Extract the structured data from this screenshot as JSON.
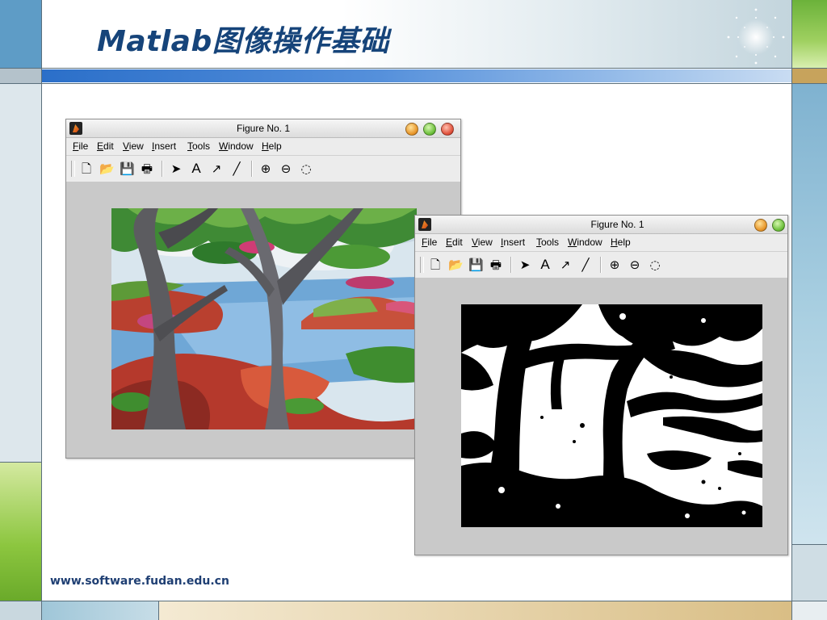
{
  "slide": {
    "title": "Matlab图像操作基础",
    "footer_url": "www.software.fudan.edu.cn"
  },
  "colors": {
    "title": "#16447a",
    "accent_bar": "#2b6fc9",
    "green_block": "#7cc241",
    "teal_block": "#9fc3d3"
  },
  "windows": [
    {
      "title": "Figure No. 1",
      "image": "color landscape painting of trees and water",
      "menu": [
        "File",
        "Edit",
        "View",
        "Insert",
        "Tools",
        "Window",
        "Help"
      ],
      "toolbar_icons": [
        "new-file-icon",
        "open-folder-icon",
        "save-icon",
        "print-icon",
        "pointer-icon",
        "text-icon",
        "arrow-icon",
        "line-icon",
        "zoom-in-icon",
        "zoom-out-icon",
        "rotate-icon"
      ]
    },
    {
      "title": "Figure No. 1",
      "image": "binary black and white version of the landscape",
      "menu": [
        "File",
        "Edit",
        "View",
        "Insert",
        "Tools",
        "Window",
        "Help"
      ],
      "toolbar_icons": [
        "new-file-icon",
        "open-folder-icon",
        "save-icon",
        "print-icon",
        "pointer-icon",
        "text-icon",
        "arrow-icon",
        "line-icon",
        "zoom-in-icon",
        "zoom-out-icon",
        "rotate-icon"
      ]
    }
  ]
}
